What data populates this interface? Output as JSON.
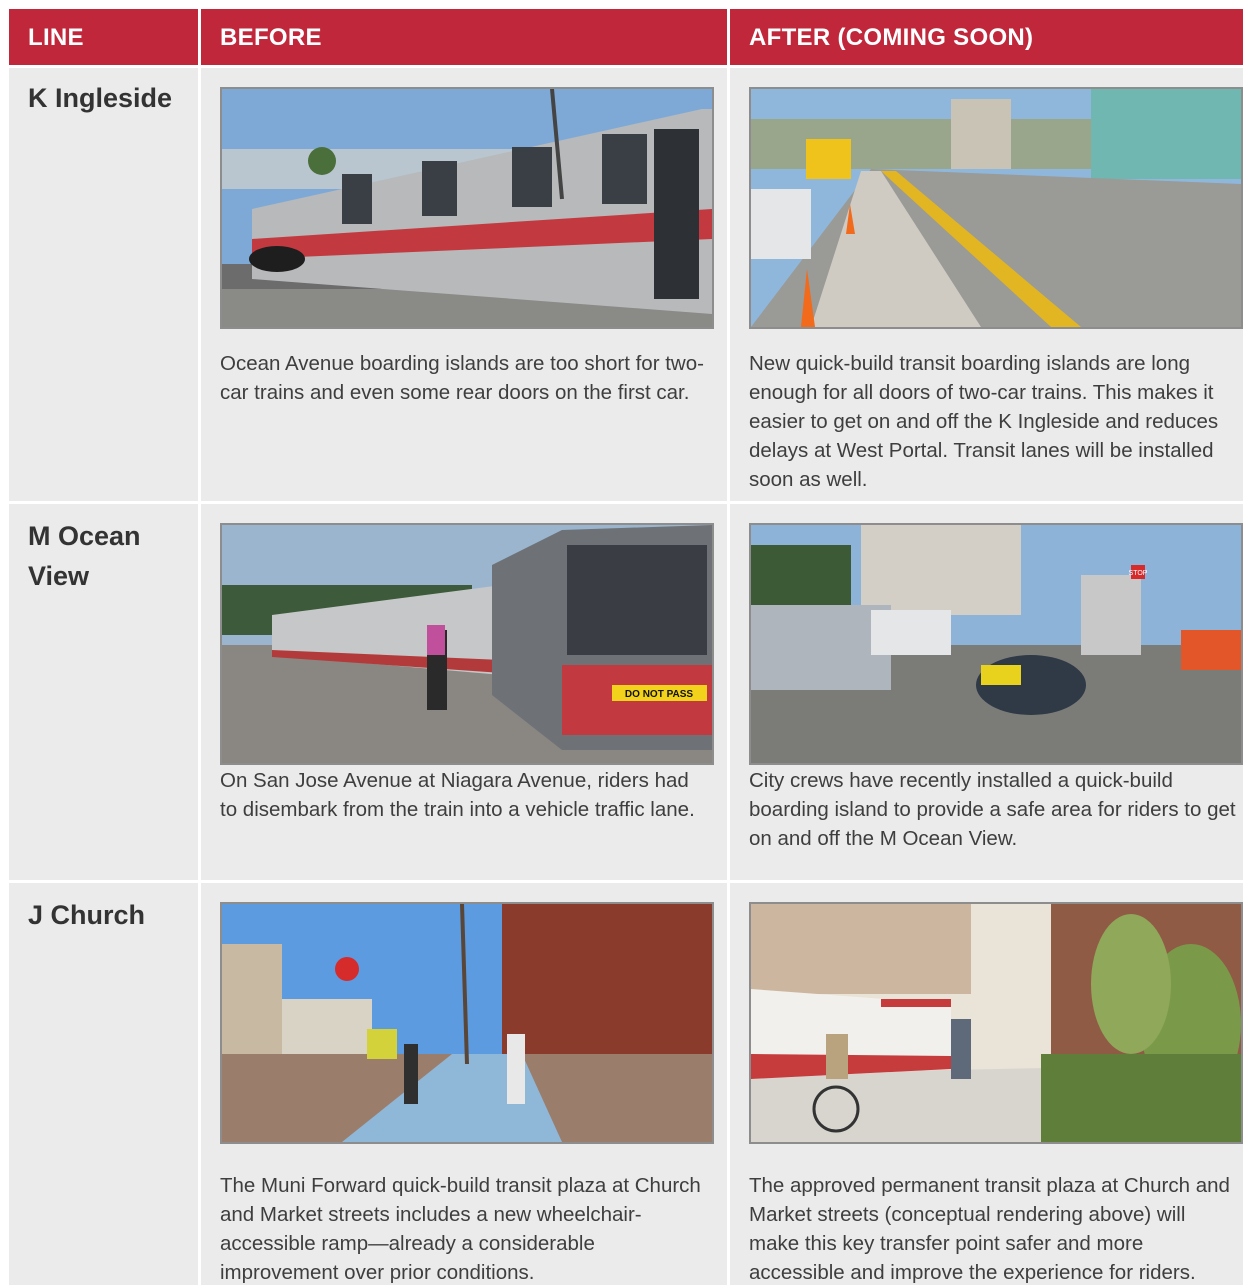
{
  "header": {
    "col_line": "LINE",
    "col_before": "BEFORE",
    "col_after": "AFTER (COMING SOON)"
  },
  "colors": {
    "header_bg": "#c1273b",
    "cell_bg": "#ebebeb"
  },
  "rows": [
    {
      "line": "K Ingleside",
      "before_caption": "Ocean Avenue boarding islands are too short for two-car trains and even some rear doors on the first car.",
      "after_caption": "New quick-build transit boarding islands are long enough for all doors of two-car trains. This makes it easier to get on and off the K Ingleside and reduces delays at West Portal. Transit lanes will be installed soon as well.",
      "before_photo_sign": "",
      "after_photo_sign": ""
    },
    {
      "line_part1": "M Ocean",
      "line_part2": "View",
      "before_caption": "On San Jose Avenue at Niagara Avenue, riders had to disembark from the train into a vehicle traffic lane.",
      "after_caption": "City crews have recently installed a quick-build boarding island to provide a safe area for riders to get on and off the M Ocean View.",
      "before_photo_sign": "DO NOT PASS",
      "after_photo_sign": "STOP"
    },
    {
      "line": "J Church",
      "before_caption": "The Muni Forward quick-build transit plaza at Church and Market streets includes a new wheelchair-accessible ramp—already a considerable improvement over prior conditions.",
      "after_caption": "The approved permanent transit plaza at Church and Market streets (conceptual rendering above) will make this key transfer point safer and more accessible and improve the experience for riders.",
      "before_photo_sign": "",
      "after_photo_sign": ""
    }
  ]
}
